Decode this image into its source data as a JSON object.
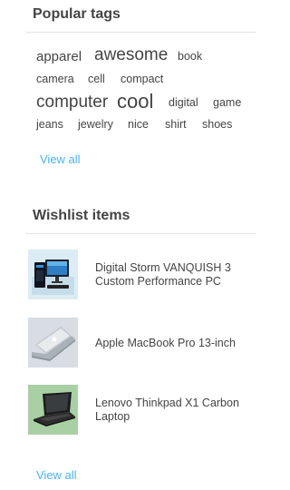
{
  "tags_block": {
    "title": "Popular tags",
    "tags": [
      {
        "label": "apparel"
      },
      {
        "label": "awesome"
      },
      {
        "label": "book"
      },
      {
        "label": "camera"
      },
      {
        "label": "cell"
      },
      {
        "label": "compact"
      },
      {
        "label": "computer"
      },
      {
        "label": "cool"
      },
      {
        "label": "digital"
      },
      {
        "label": "game"
      },
      {
        "label": "jeans"
      },
      {
        "label": "jewelry"
      },
      {
        "label": "nice"
      },
      {
        "label": "shirt"
      },
      {
        "label": "shoes"
      }
    ],
    "view_all": "View all"
  },
  "wishlist_block": {
    "title": "Wishlist items",
    "items": [
      {
        "name": "Digital Storm VANQUISH 3 Custom Performance PC",
        "thumb": "desktop-pc-icon"
      },
      {
        "name": "Apple MacBook Pro 13-inch",
        "thumb": "macbook-icon"
      },
      {
        "name": "Lenovo Thinkpad X1 Carbon Laptop",
        "thumb": "thinkpad-icon"
      }
    ],
    "view_all": "View all"
  },
  "colors": {
    "link": "#4ab2f1",
    "text": "#444444",
    "divider": "#e4e4e4"
  }
}
